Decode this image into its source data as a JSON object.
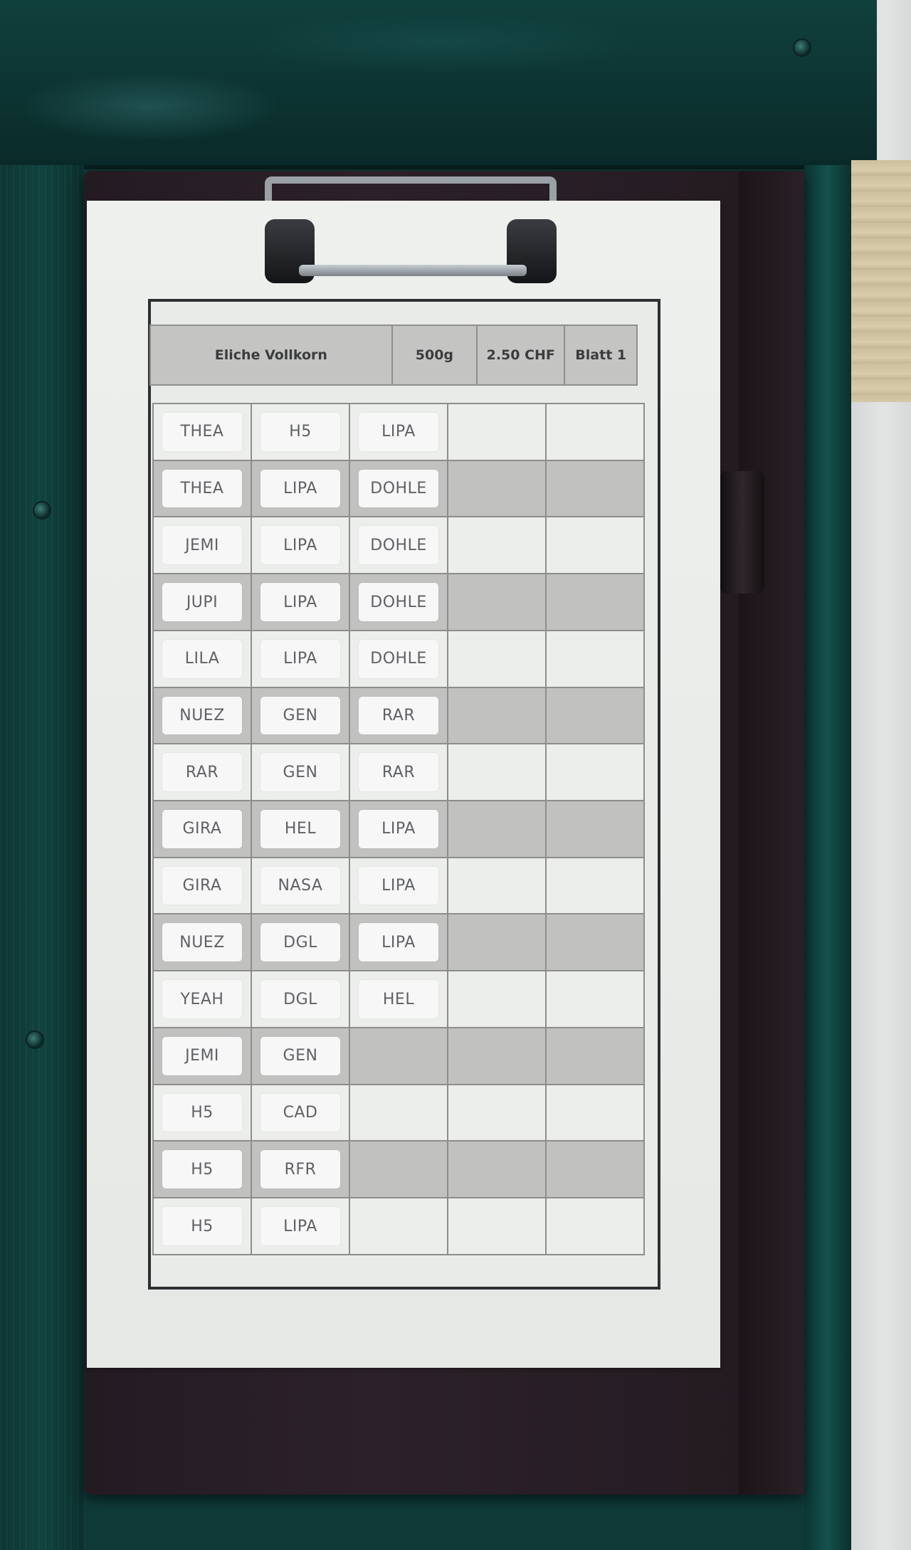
{
  "sheet": {
    "header": {
      "product": "Eliche Vollkorn",
      "weight": "500g",
      "price": "2.50 CHF",
      "page": "Blatt 1"
    },
    "rows": [
      [
        "THEA",
        "H5",
        "LIPA",
        "",
        ""
      ],
      [
        "THEA",
        "LIPA",
        "DOHLE",
        "",
        ""
      ],
      [
        "JEMI",
        "LIPA",
        "DOHLE",
        "",
        ""
      ],
      [
        "JUPI",
        "LIPA",
        "DOHLE",
        "",
        ""
      ],
      [
        "LILA",
        "LIPA",
        "DOHLE",
        "",
        ""
      ],
      [
        "NUEZ",
        "GEN",
        "RAR",
        "",
        ""
      ],
      [
        "RAR",
        "GEN",
        "RAR",
        "",
        ""
      ],
      [
        "GIRA",
        "HEL",
        "LIPA",
        "",
        ""
      ],
      [
        "GIRA",
        "NASA",
        "LIPA",
        "",
        ""
      ],
      [
        "NUEZ",
        "DGL",
        "LIPA",
        "",
        ""
      ],
      [
        "YEAH",
        "DGL",
        "HEL",
        "",
        ""
      ],
      [
        "JEMI",
        "GEN",
        "",
        "",
        ""
      ],
      [
        "H5",
        "CAD",
        "",
        "",
        ""
      ],
      [
        "H5",
        "RFR",
        "",
        "",
        ""
      ],
      [
        "H5",
        "LIPA",
        "",
        "",
        ""
      ]
    ]
  }
}
